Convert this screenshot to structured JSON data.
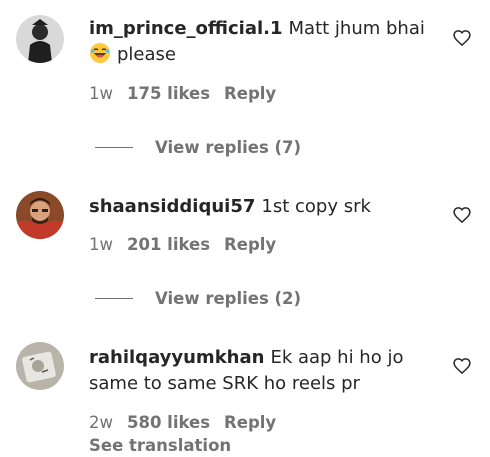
{
  "comments": [
    {
      "username": "im_prince_official.1",
      "text_line1": "Matt jhum bhai",
      "text_line2": "please",
      "emoji": "laughing-face",
      "time": "1w",
      "likes": "175 likes",
      "reply": "Reply",
      "view_replies": "View replies (7)"
    },
    {
      "username": "shaansiddiqui57",
      "text": "1st copy srk",
      "time": "1w",
      "likes": "201 likes",
      "reply": "Reply",
      "view_replies": "View replies (2)"
    },
    {
      "username": "rahilqayyumkhan",
      "text_line1": "Ek aap hi ho jo",
      "text_line2": "same to same SRK ho reels pr",
      "time": "2w",
      "likes": "580 likes",
      "reply": "Reply",
      "see_translation": "See translation"
    }
  ],
  "colors": {
    "primary_text": "#262626",
    "secondary_text": "#737373",
    "background": "#ffffff"
  }
}
